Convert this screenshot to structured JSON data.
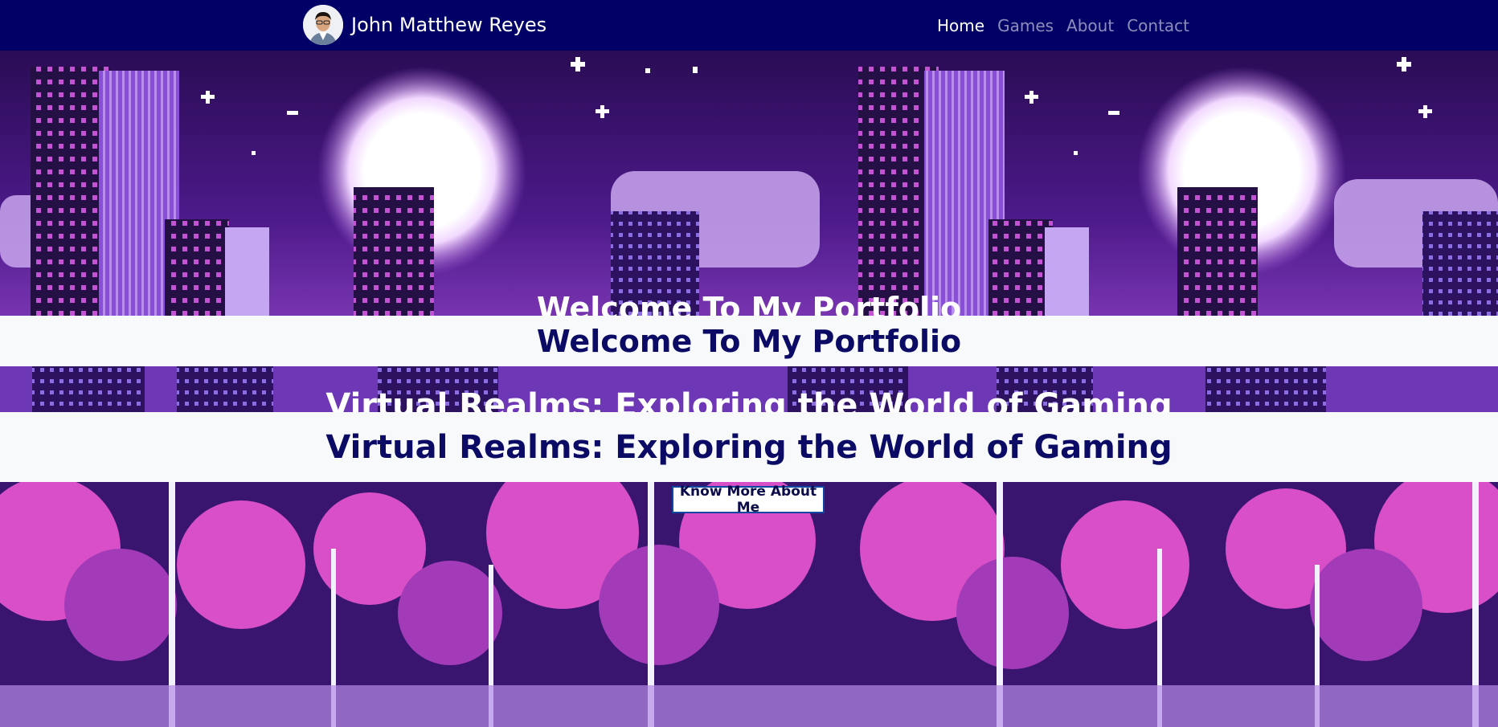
{
  "navbar": {
    "brand_name": "John Matthew Reyes",
    "links": [
      {
        "label": "Home",
        "active": true
      },
      {
        "label": "Games",
        "active": false
      },
      {
        "label": "About",
        "active": false
      },
      {
        "label": "Contact",
        "active": false
      }
    ]
  },
  "hero": {
    "welcome_heading": "Welcome To My Portfolio",
    "tagline": "Virtual Realms: Exploring the World of Gaming",
    "cta_label": "Know More About Me",
    "background_icon": "pixel-city-night-scene"
  },
  "colors": {
    "navbar_bg": "#000066",
    "band_bg": "#f8f9fb",
    "heading_text": "#0b0b66",
    "sky_purple": "#5a1f99",
    "tree_pink": "#d94fc8"
  }
}
